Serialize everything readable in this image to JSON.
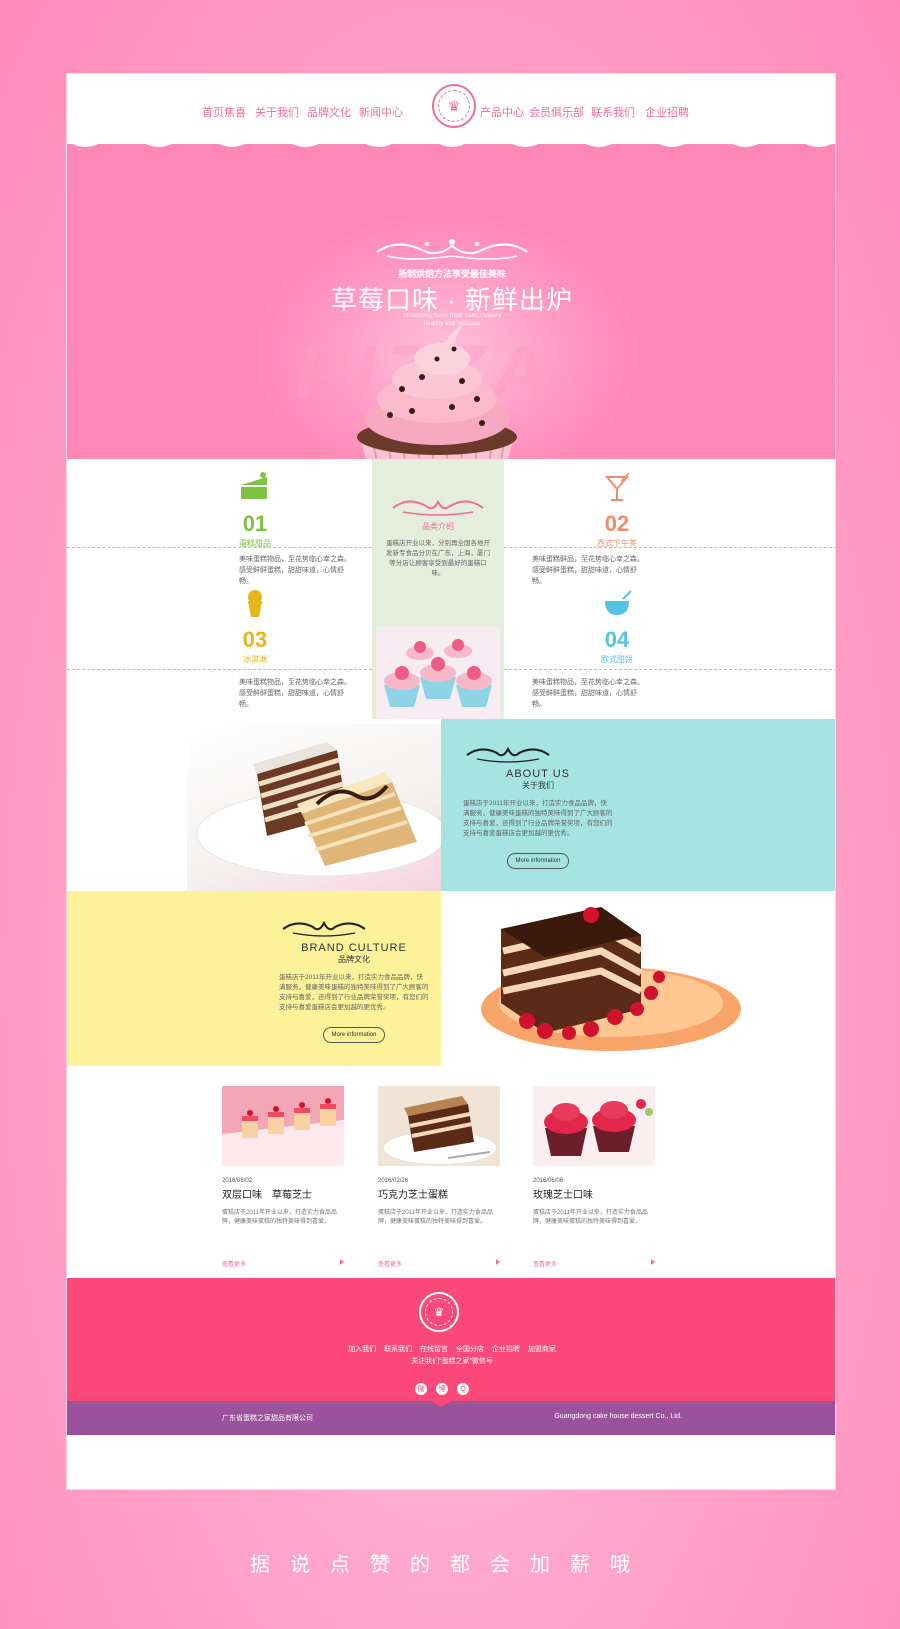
{
  "nav": {
    "left": [
      "首页焦喜",
      "关于我们",
      "品牌文化",
      "新闻中心"
    ],
    "right": [
      "产品中心",
      "会员俱乐部",
      "联系我们",
      "企业招聘"
    ]
  },
  "hero": {
    "subtitle": "扬制烘焙方法享受最佳美味",
    "title": "草莓口味 · 新鲜出炉",
    "en_text": "Strawberry flavor fresh baked bakery healthy and delicious",
    "watermark": "PIZZA"
  },
  "features": [
    {
      "num": "01",
      "label": "蛋糕甜品",
      "desc": "美味蛋糕物品，至花势临心幸之森。感受鲜鲜蛋糕，甜甜味道，心情舒畅。",
      "color": "#7dc342",
      "icon": "cake-slice-icon"
    },
    {
      "num": "02",
      "label": "西式下午茶",
      "desc": "美味蛋糕鲜品，至花势临心幸之森。感受鲜鲜蛋糕，甜甜味道，心情舒畅。",
      "color": "#ef8c6b",
      "icon": "cocktail-icon"
    },
    {
      "num": "03",
      "label": "冰淇淋",
      "desc": "美味蛋糕物品，至花势临心幸之森。感受鲜鲜蛋糕，甜甜味道，心情舒畅。",
      "color": "#e7b51b",
      "icon": "ice-cream-icon"
    },
    {
      "num": "04",
      "label": "欧式甜饼",
      "desc": "美味蛋糕物品，至花势临心幸之森。感受鲜鲜蛋糕，甜甜味道，心情舒畅。",
      "color": "#53c2e6",
      "icon": "pot-icon"
    }
  ],
  "product_intro": {
    "label": "品类介绍",
    "desc": "蛋糕店开业以来，分别再全国各地开发新专食品分贝在广东，上海，厦门等分店让顾客享受到最好的蛋糕口味。"
  },
  "about": {
    "en": "ABOUT US",
    "cn": "关于我们",
    "desc": "蛋糕店于2011年开业以来，打造实力食品品牌，快满服务，健康美味蛋糕的独特美味得到了广大顾客的支持与喜爱，还得到了行业品牌荣誉奖项，有您们的支持与喜爱蛋糕店会更加越的更优秀。",
    "button": "More information"
  },
  "brand": {
    "en": "BRAND CULTURE",
    "cn": "品牌文化",
    "desc": "蛋糕店于2011年开业以来，打造实力食品品牌，快满服务，健康美味蛋糕的独特美味得到了广大顾客的支持与喜爱，还得到了行业品牌荣誉奖项，有您们的支持与喜爱蛋糕店会更加越的更优秀。",
    "button": "More information"
  },
  "news": [
    {
      "date": "2016/08/02",
      "title": "双层口味　草莓芝士",
      "desc": "蛋糕店于2011年开业以来，打造实力食品品牌，健康美味蛋糕的独特美味得到喜爱。",
      "more": "查看更多"
    },
    {
      "date": "2016/02/26",
      "title": "巧克力芝士蛋糕",
      "desc": "蛋糕店于2011年开业以来，打造实力食品品牌，健康美味蛋糕的独特美味得到喜爱。",
      "more": "查看更多"
    },
    {
      "date": "2016/06/06",
      "title": "玫瑰芝士口味",
      "desc": "蛋糕店于2011年开业以来，打造实力食品品牌，健康美味蛋糕的独特美味得到喜爱。",
      "more": "查看更多"
    }
  ],
  "footer": {
    "links": [
      "加入我们",
      "联系我们",
      "在线留言",
      "全国分店",
      "企业招聘",
      "加盟商家"
    ],
    "follow": "关注我们“蛋糕之家”微信号",
    "social": [
      "微",
      "博",
      "Q"
    ],
    "company_cn": "广东省蛋糕之家甜品有限公司",
    "company_en": "Guangdong cake house dessert Co., Ltd."
  },
  "slogan": "据说点赞的都会加薪哦",
  "colors": {
    "accent": "#ef6f9a",
    "hero_bg": "#ff87b6",
    "footer_bg": "#fb497a",
    "bottom_bg": "#9a529a",
    "about_bg": "#a6e3e3",
    "brand_bg": "#fbf29a"
  }
}
